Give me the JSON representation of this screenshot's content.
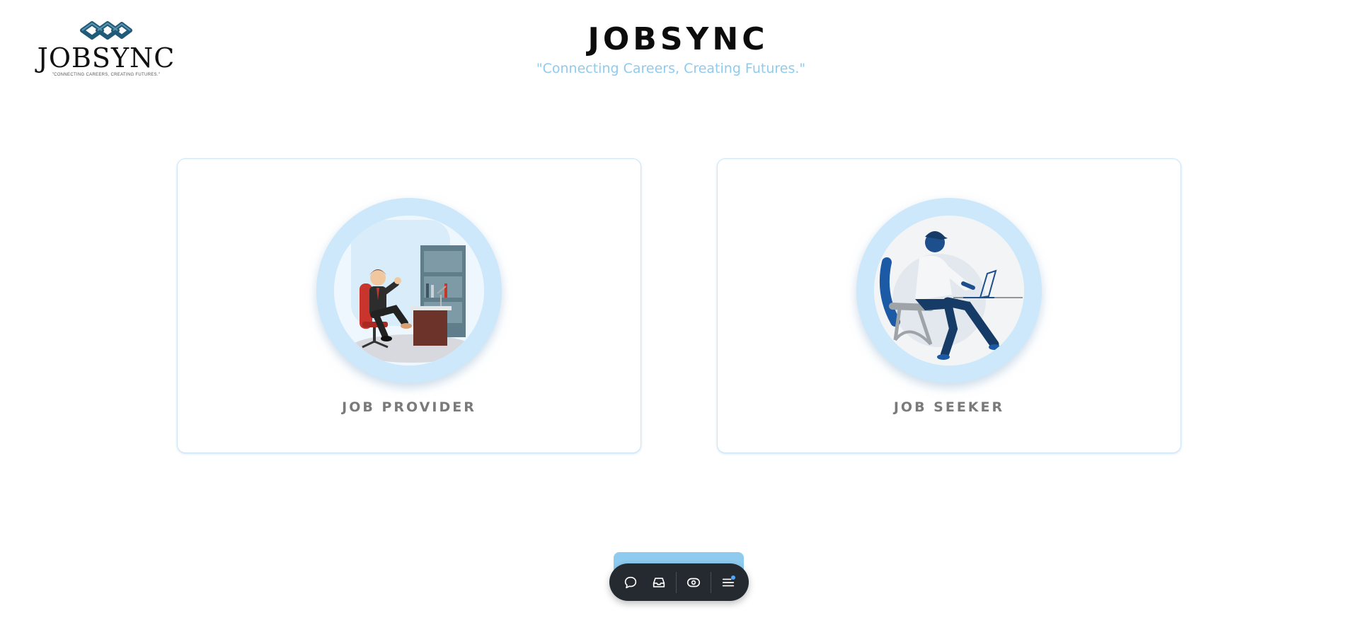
{
  "logo": {
    "wordmark": "JOBSYNC",
    "slogan": "\"CONNECTING CAREERS, CREATING FUTURES.\""
  },
  "header": {
    "title": "JOBSYNC",
    "tagline": "\"Connecting Careers, Creating Futures.\""
  },
  "cards": [
    {
      "label": "JOB PROVIDER",
      "illustration": "businessman-at-desk"
    },
    {
      "label": "JOB SEEKER",
      "illustration": "man-working-on-laptop"
    }
  ],
  "toolbar": {
    "buttons": [
      "chat-icon",
      "inbox-icon",
      "eye-icon",
      "menu-icon"
    ]
  },
  "colors": {
    "accent": "#8fcbee",
    "ring": "#cde8fb",
    "toolbar": "#252a30",
    "logo": "#1f5a78",
    "label": "#7a7a7a"
  }
}
